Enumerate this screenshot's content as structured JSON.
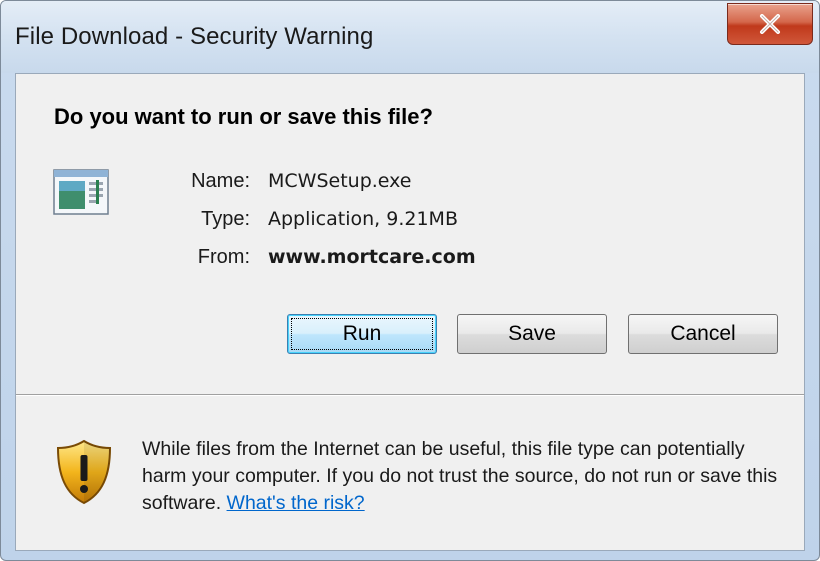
{
  "window": {
    "title": "File Download - Security Warning"
  },
  "dialog": {
    "question": "Do you want to run or save this file?",
    "file": {
      "name_label": "Name:",
      "name_value": "MCWSetup.exe",
      "type_label": "Type:",
      "type_value": "Application, 9.21MB",
      "from_label": "From:",
      "from_value": "www.mortcare.com"
    },
    "buttons": {
      "run": "Run",
      "save": "Save",
      "cancel": "Cancel"
    },
    "warning": {
      "text": "While files from the Internet can be useful, this file type can potentially harm your computer. If you do not trust the source, do not run or save this software.",
      "link": "What's the risk?"
    }
  },
  "icons": {
    "close": "close-icon",
    "file": "application-file-icon",
    "warning": "security-shield-icon"
  },
  "colors": {
    "link": "#0066cc",
    "close_button": "#c0391b",
    "default_button_border": "#3c7fb1"
  }
}
